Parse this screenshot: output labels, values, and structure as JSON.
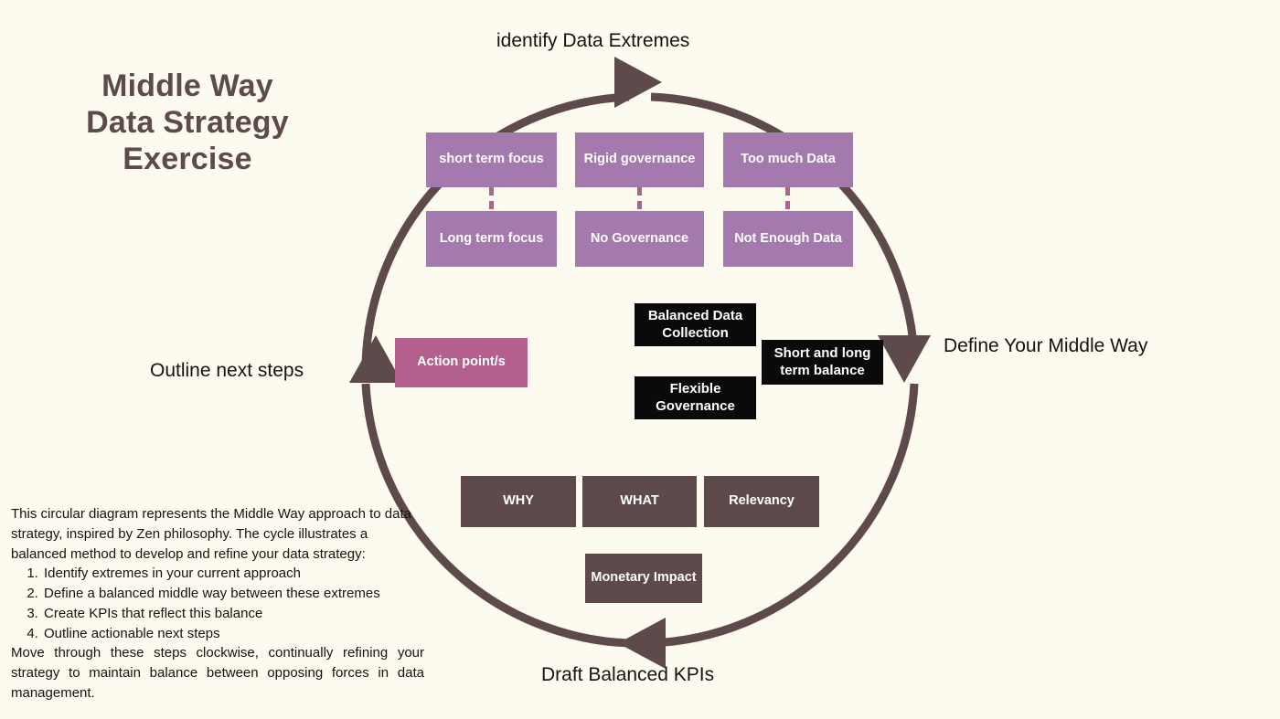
{
  "title": {
    "line1": "Middle Way",
    "line2": "Data Strategy",
    "line3": "Exercise"
  },
  "colors": {
    "background": "#fdfaf0",
    "circle_stroke": "#5e4a4a",
    "title_text": "#5e4a4a",
    "extreme_box": "#a379ae",
    "connector_dash": "#b3608f",
    "action_box": "#b3608f",
    "middle_way_box": "#0a0a0a",
    "kpi_box": "#5e4a4a",
    "label_text": "#16120f"
  },
  "cycle": {
    "direction": "clockwise",
    "steps": [
      {
        "id": "identify",
        "label": "identify Data Extremes",
        "position": "top"
      },
      {
        "id": "define",
        "label": "Define Your Middle Way",
        "position": "right"
      },
      {
        "id": "draft",
        "label": "Draft Balanced KPIs",
        "position": "bottom"
      },
      {
        "id": "outline",
        "label": "Outline next steps",
        "position": "left"
      }
    ]
  },
  "extremes": {
    "pairs": [
      {
        "top": "short term focus",
        "bottom": "Long term focus"
      },
      {
        "top": "Rigid governance",
        "bottom": "No Governance"
      },
      {
        "top": "Too much Data",
        "bottom": "Not Enough Data"
      }
    ]
  },
  "middle_way": {
    "items": [
      "Balanced Data Collection",
      "Short and long term balance",
      "Flexible Governance"
    ]
  },
  "kpis": {
    "items": [
      "WHY",
      "WHAT",
      "Relevancy",
      "Monetary Impact"
    ]
  },
  "action": {
    "label": "Action point/s"
  },
  "description": {
    "intro": "This circular diagram represents the Middle Way approach to data strategy, inspired by Zen philosophy. The cycle illustrates a balanced method to develop and refine your data strategy:",
    "steps": [
      "Identify extremes in your current approach",
      "Define a balanced middle way between these extremes",
      "Create KPIs that reflect this balance",
      "Outline actionable next steps"
    ],
    "outro": "Move through these steps clockwise, continually refining your strategy to maintain balance between opposing forces in data management."
  }
}
